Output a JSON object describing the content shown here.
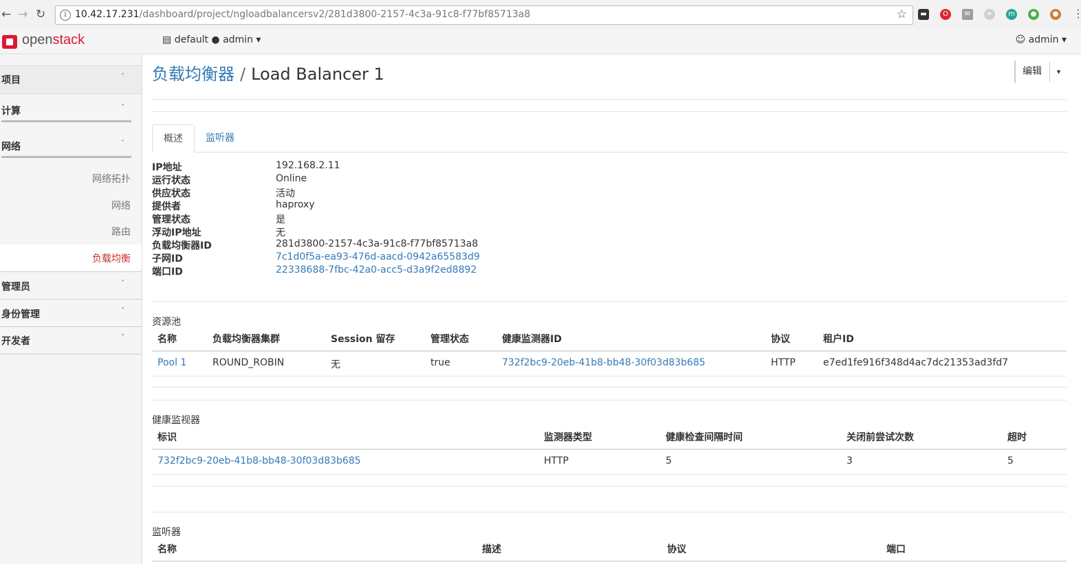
{
  "browser": {
    "url_host": "10.42.17.231",
    "url_path": "/dashboard/project/ngloadbalancersv2/281d3800-2157-4c3a-91c8-f77bf85713a8",
    "extensions": [
      {
        "name": "spy-icon",
        "color": "#333333",
        "glyph": "▬"
      },
      {
        "name": "opera-icon",
        "color": "#e0272e",
        "glyph": "O"
      },
      {
        "name": "mail-icon",
        "color": "#9e9e9e",
        "glyph": "✉"
      },
      {
        "name": "feather-icon",
        "color": "#bdbdbd",
        "glyph": "❧"
      },
      {
        "name": "m-icon",
        "color": "#26a69a",
        "glyph": "m"
      },
      {
        "name": "chrome-icon",
        "color": "#4caf50",
        "glyph": "●"
      },
      {
        "name": "cookie-icon",
        "color": "#c8803a",
        "glyph": "●"
      }
    ]
  },
  "header": {
    "logo_left": "open",
    "logo_right": "stack",
    "project_icon": "▤",
    "project": "default",
    "project_dot": "●",
    "project_user": "admin",
    "caret": "▾",
    "user_icon": "☺",
    "user": "admin"
  },
  "sidebar": {
    "sections": [
      {
        "label": "项目",
        "chev": "˄"
      },
      {
        "label": "计算",
        "chev": "˅"
      },
      {
        "label": "网络",
        "chev": "˄"
      },
      {
        "label": "管理员",
        "chev": "˅"
      },
      {
        "label": "身份管理",
        "chev": "˅"
      },
      {
        "label": "开发者",
        "chev": "˅"
      }
    ],
    "network_items": [
      "网络拓扑",
      "网络",
      "路由",
      "负载均衡"
    ]
  },
  "page": {
    "crumb": "负载均衡器",
    "sep": "/",
    "title": "Load Balancer 1",
    "edit_label": "编辑",
    "edit_caret": "▾"
  },
  "tabs": [
    "概述",
    "监听器"
  ],
  "overview": [
    {
      "k": "IP地址",
      "v": "192.168.2.11"
    },
    {
      "k": "运行状态",
      "v": "Online"
    },
    {
      "k": "供应状态",
      "v": "活动"
    },
    {
      "k": "提供者",
      "v": "haproxy"
    },
    {
      "k": "管理状态",
      "v": "是"
    },
    {
      "k": "浮动IP地址",
      "v": "无"
    },
    {
      "k": "负载均衡器ID",
      "v": "281d3800-2157-4c3a-91c8-f77bf85713a8"
    },
    {
      "k": "子网ID",
      "v": "7c1d0f5a-ea93-476d-aacd-0942a65583d9"
    },
    {
      "k": "端口ID",
      "v": "22338688-7fbc-42a0-acc5-d3a9f2ed8892"
    }
  ],
  "pools": {
    "title": "资源池",
    "headers": [
      "名称",
      "负载均衡器集群",
      "Session 留存",
      "管理状态",
      "健康监测器ID",
      "协议",
      "租户ID"
    ],
    "row": [
      "Pool 1",
      "ROUND_ROBIN",
      "无",
      "true",
      "732f2bc9-20eb-41b8-bb48-30f03d83b685",
      "HTTP",
      "e7ed1fe916f348d4ac7dc21353ad3fd7"
    ]
  },
  "monitors": {
    "title": "健康监视器",
    "headers": [
      "标识",
      "监测器类型",
      "健康检查间隔时间",
      "关闭前尝试次数",
      "超时"
    ],
    "row": [
      "732f2bc9-20eb-41b8-bb48-30f03d83b685",
      "HTTP",
      "5",
      "3",
      "5"
    ]
  },
  "listeners": {
    "title": "监听器",
    "headers": [
      "名称",
      "描述",
      "协议",
      "端口"
    ]
  }
}
